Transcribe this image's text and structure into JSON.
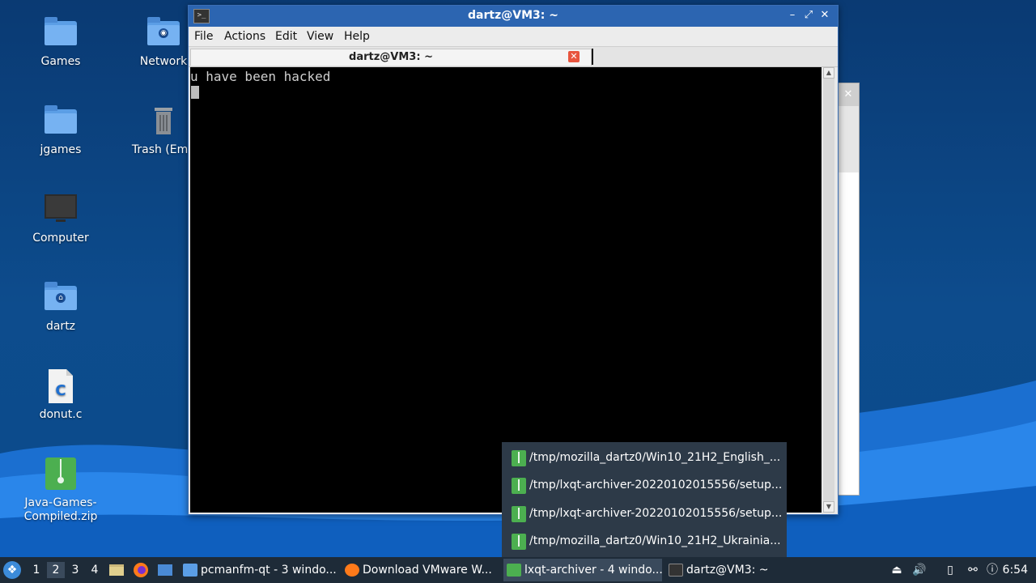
{
  "colors": {
    "titlebar": "#2c65b1",
    "taskbar": "#1e2b38",
    "popup": "#2d3a48",
    "folder": "#5b9ee6",
    "zip_green": "#4caf50"
  },
  "desktop": {
    "icons": [
      {
        "label": "Games",
        "icon": "folder-icon"
      },
      {
        "label": "Network",
        "icon": "network-folder-icon"
      },
      {
        "label": "jgames",
        "icon": "folder-icon"
      },
      {
        "label": "Trash (Emp",
        "icon": "trash-icon"
      },
      {
        "label": "Computer",
        "icon": "computer-icon"
      },
      {
        "label": "dartz",
        "icon": "home-folder-icon"
      },
      {
        "label": "donut.c",
        "icon": "c-source-file-icon"
      },
      {
        "label": "Java-Games-Compiled.zip",
        "icon": "zip-file-icon"
      }
    ]
  },
  "terminal": {
    "window_title": "dartz@VM3: ~",
    "menu": [
      "File",
      "Actions",
      "Edit",
      "View",
      "Help"
    ],
    "tab_title": "dartz@VM3: ~",
    "output_line": "u have been hacked",
    "buttons": {
      "minimize": "–",
      "maximize": "⤢",
      "close": "✕"
    }
  },
  "popup": {
    "items": [
      "/tmp/mozilla_dartz0/Win10_21H2_English_...",
      "/tmp/lxqt-archiver-20220102015556/setup....",
      "/tmp/lxqt-archiver-20220102015556/setup....",
      "/tmp/mozilla_dartz0/Win10_21H2_Ukrainia..."
    ]
  },
  "taskbar": {
    "workspaces": [
      "1",
      "2",
      "3",
      "4"
    ],
    "active_workspace": "2",
    "tasks": [
      {
        "label": "pcmanfm-qt - 3 windo...",
        "icon": "folder-icon"
      },
      {
        "label": "Download VMware W...",
        "icon": "firefox-icon"
      },
      {
        "label": "lxqt-archiver - 4 windo...",
        "icon": "archive-icon"
      },
      {
        "label": "dartz@VM3: ~",
        "icon": "terminal-icon"
      }
    ],
    "clock": "6:54"
  }
}
